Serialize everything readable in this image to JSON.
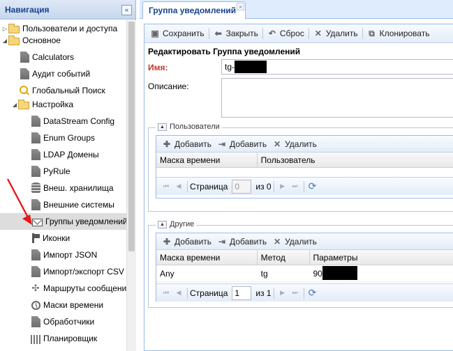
{
  "nav": {
    "title": "Навигация",
    "items": [
      {
        "label": "Пользователи и доступа",
        "icon": "folder-icon",
        "arrow": "▷"
      },
      {
        "label": "Основное",
        "icon": "folder-open-icon",
        "arrow": "◢"
      },
      {
        "label": "Calculators",
        "icon": "document-icon"
      },
      {
        "label": "Аудит событий",
        "icon": "document-icon"
      },
      {
        "label": "Глобальный Поиск",
        "icon": "search-icon"
      },
      {
        "label": "Настройка",
        "icon": "folder-open-icon",
        "arrow": "◢"
      },
      {
        "label": "DataStream Config",
        "icon": "document-icon"
      },
      {
        "label": "Enum Groups",
        "icon": "document-icon"
      },
      {
        "label": "LDAP Домены",
        "icon": "document-icon"
      },
      {
        "label": "PyRule",
        "icon": "document-icon"
      },
      {
        "label": "Внеш. хранилища",
        "icon": "database-icon"
      },
      {
        "label": "Внешние системы",
        "icon": "document-icon"
      },
      {
        "label": "Группы уведомлений",
        "icon": "envelope-icon"
      },
      {
        "label": "Иконки",
        "icon": "pin-icon"
      },
      {
        "label": "Импорт JSON",
        "icon": "document-icon"
      },
      {
        "label": "Импорт/экспорт CSV",
        "icon": "document-icon"
      },
      {
        "label": "Маршруты сообщений",
        "icon": "routes-icon"
      },
      {
        "label": "Маски времени",
        "icon": "clock-icon"
      },
      {
        "label": "Обработчики",
        "icon": "document-icon"
      },
      {
        "label": "Планировщик",
        "icon": "scheduler-icon"
      }
    ]
  },
  "tab": {
    "label": "Группа уведомлений",
    "close": "×"
  },
  "toolbar": {
    "save": "Сохранить",
    "close": "Закрыть",
    "reset": "Сброс",
    "delete": "Удалить",
    "clone": "Клонировать"
  },
  "form": {
    "title": "Редактировать Группа уведомлений",
    "name_label": "Имя:",
    "name_value": "tg-",
    "desc_label": "Описание:"
  },
  "users": {
    "legend": "Пользователи",
    "add1": "Добавить",
    "add2": "Добавить",
    "delete": "Удалить",
    "columns": [
      "Маска времени",
      "Пользователь"
    ],
    "pager": {
      "page_label": "Страница",
      "page_value": "0",
      "of": "из 0"
    }
  },
  "others": {
    "legend": "Другие",
    "add1": "Добавить",
    "add2": "Добавить",
    "delete": "Удалить",
    "columns": [
      "Маска времени",
      "Метод",
      "Параметры"
    ],
    "row": {
      "mask": "Any",
      "method": "tg",
      "params": "90"
    },
    "pager": {
      "page_label": "Страница",
      "page_value": "1",
      "of": "из 1"
    }
  }
}
